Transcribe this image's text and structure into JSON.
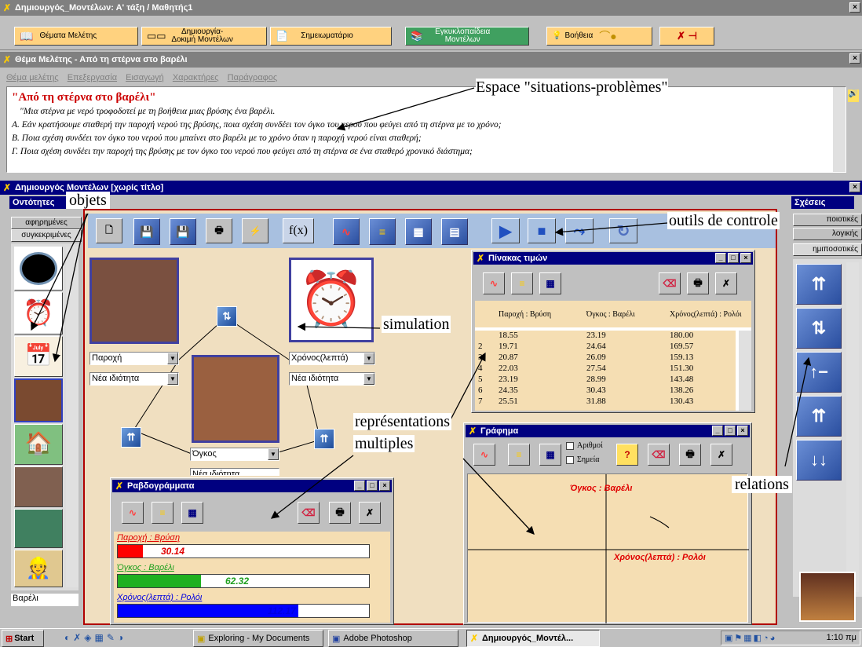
{
  "main_window": {
    "title": "Δημιουργός_Μοντέλων: Α' τάξη / Μαθητής1"
  },
  "main_toolbar": {
    "topics": "Θέματα Μελέτης",
    "model_create": "Δημιουργία-Δοκιμή Μοντέλων",
    "notebook": "Σημειωματάριο",
    "encyclopedia": "Εγκυκλοπαίδεια Μοντέλων",
    "help": "Βοήθεια"
  },
  "topic_window": {
    "title": "Θέμα Μελέτης - Από τη στέρνα στο βαρέλι",
    "menu": [
      "Θέμα μελέτης",
      "Επεξεργασία",
      "Εισαγωγή",
      "Χαρακτήρες",
      "Παράγραφος"
    ],
    "heading": "\"Από τη στέρνα στο βαρέλι\"",
    "lines": [
      "\"Μια στέρνα με νερό τροφοδοτεί με τη βοήθεια μιας βρύσης ένα βαρέλι.",
      "Α. Εάν κρατήσουμε σταθερή την παροχή νερού της βρύσης, ποια σχέση συνδέει τον όγκο του νερού που φεύγει από τη στέρνα με το χρόνο;",
      "Β. Ποια σχέση συνδέει τον όγκο του νερού που μπαίνει στο βαρέλι με το χρόνο όταν η παροχή νερού είναι σταθερή;",
      "Γ. Ποια σχέση συνδέει την παροχή της βρύσης με τον όγκο του νερού που φεύγει από τη στέρνα σε ένα σταθερό χρονικό διάστημα;"
    ]
  },
  "model_window": {
    "title": "Δημιουργός Μοντέλων [χωρίς τίτλο]",
    "left_panel_title": "Οντότητες",
    "left_tabs": [
      "αφηρημένες",
      "συγκεκριμένες"
    ],
    "left_status": "Βαρέλι",
    "right_panel_title": "Σχέσεις",
    "right_tabs": [
      "ποιοτικές",
      "λογικής",
      "ημιποσοτικές"
    ],
    "fx_label": "f(x)",
    "entity_tap": {
      "property": "Παροχή",
      "new_property": "Νέα ιδιότητα"
    },
    "entity_clock": {
      "property": "Χρόνος(λεπτά)",
      "new_property": "Νέα ιδιότητα"
    },
    "entity_barrel": {
      "property": "Όγκος",
      "new_property": "Νέα ιδιότητα"
    }
  },
  "values_table": {
    "title": "Πίνακας τιμών",
    "columns": [
      "Παροχή : Βρύση",
      "Όγκος : Βαρέλι",
      "Χρόνος(λεπτά) : Ρολόι"
    ],
    "rows": [
      {
        "n": "",
        "a": "18.55",
        "b": "23.19",
        "c": "180.00"
      },
      {
        "n": "2",
        "a": "19.71",
        "b": "24.64",
        "c": "169.57"
      },
      {
        "n": "3",
        "a": "20.87",
        "b": "26.09",
        "c": "159.13"
      },
      {
        "n": "4",
        "a": "22.03",
        "b": "27.54",
        "c": "151.30"
      },
      {
        "n": "5",
        "a": "23.19",
        "b": "28.99",
        "c": "143.48"
      },
      {
        "n": "6",
        "a": "24.35",
        "b": "30.43",
        "c": "138.26"
      },
      {
        "n": "7",
        "a": "25.51",
        "b": "31.88",
        "c": "130.43"
      }
    ]
  },
  "graph_window": {
    "title": "Γράφημα",
    "chk_numbers": "Αριθμοί",
    "chk_points": "Σημεία",
    "y_label": "Όγκος : Βαρέλι",
    "x_label": "Χρόνος(λεπτά) : Ρολόι"
  },
  "bars_window": {
    "title": "Ραβδογράμματα",
    "bars": [
      {
        "label": "Παροχή : Βρύση",
        "value": "30.14",
        "fraction": 0.1,
        "color": "#ff0000"
      },
      {
        "label": "Όγκος : Βαρέλι",
        "value": "62.32",
        "fraction": 0.33,
        "color": "#20b020"
      },
      {
        "label": "Χρόνος(λεπτά) : Ρολόι",
        "value": "112.17",
        "fraction": 0.72,
        "color": "#0000ff"
      }
    ]
  },
  "annotations": {
    "situations": "Espace \"situations-problèmes\"",
    "objets": "objets",
    "outils": "outils de controle",
    "simulation": "simulation",
    "representations_1": "représentations",
    "representations_2": "multiples",
    "relations": "relations"
  },
  "taskbar": {
    "start": "Start",
    "items": [
      "Exploring - My Documents",
      "Adobe Photoshop",
      "Δημιουργός_Μοντέλ..."
    ],
    "clock": "1:10 πμ"
  },
  "colors": {
    "accent": "#000080",
    "heading_red": "#cc0000",
    "panel_bg": "#f5deb3"
  }
}
